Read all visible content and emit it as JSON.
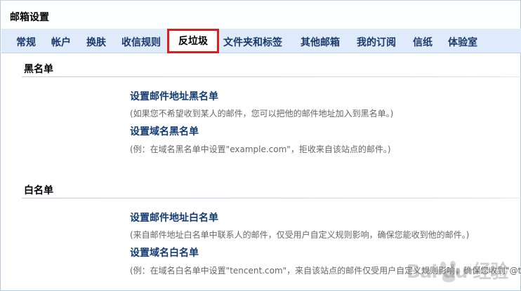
{
  "window": {
    "title": "邮箱设置"
  },
  "tabs": [
    {
      "label": "常规"
    },
    {
      "label": "帐户"
    },
    {
      "label": "换肤"
    },
    {
      "label": "收信规则"
    },
    {
      "label": "反垃圾",
      "active": true
    },
    {
      "label": "文件夹和标签"
    },
    {
      "label": "其他邮箱"
    },
    {
      "label": "我的订阅"
    },
    {
      "label": "信纸"
    },
    {
      "label": "体验室"
    }
  ],
  "blacklist": {
    "title": "黑名单",
    "address_link": "设置邮件地址黑名单",
    "address_desc": "(如果您不希望收到某人的邮件，您可以把他的邮件地址加入到黑名单。)",
    "domain_link": "设置域名黑名单",
    "domain_desc": "(例：在域名黑名单中设置\"example.com\"，拒收来自该站点的邮件。)"
  },
  "whitelist": {
    "title": "白名单",
    "address_link": "设置邮件地址白名单",
    "address_desc": "(来自邮件地址白名单中联系人的邮件，仅受用户自定义规则影响，确保您能收到他的邮件。)",
    "domain_link": "设置域名白名单",
    "domain_desc": "(例：在域名白名单中设置\"tencent.com\"，来自该站点的邮件仅受用户自定义规则影响，确保您收到\"@t"
  },
  "watermark": {
    "text": "Bai du 经验",
    "color": "#8a8a8a"
  },
  "colors": {
    "tab_bar": "#dfeafb",
    "link": "#123b74",
    "highlight": "#e21b1b"
  }
}
